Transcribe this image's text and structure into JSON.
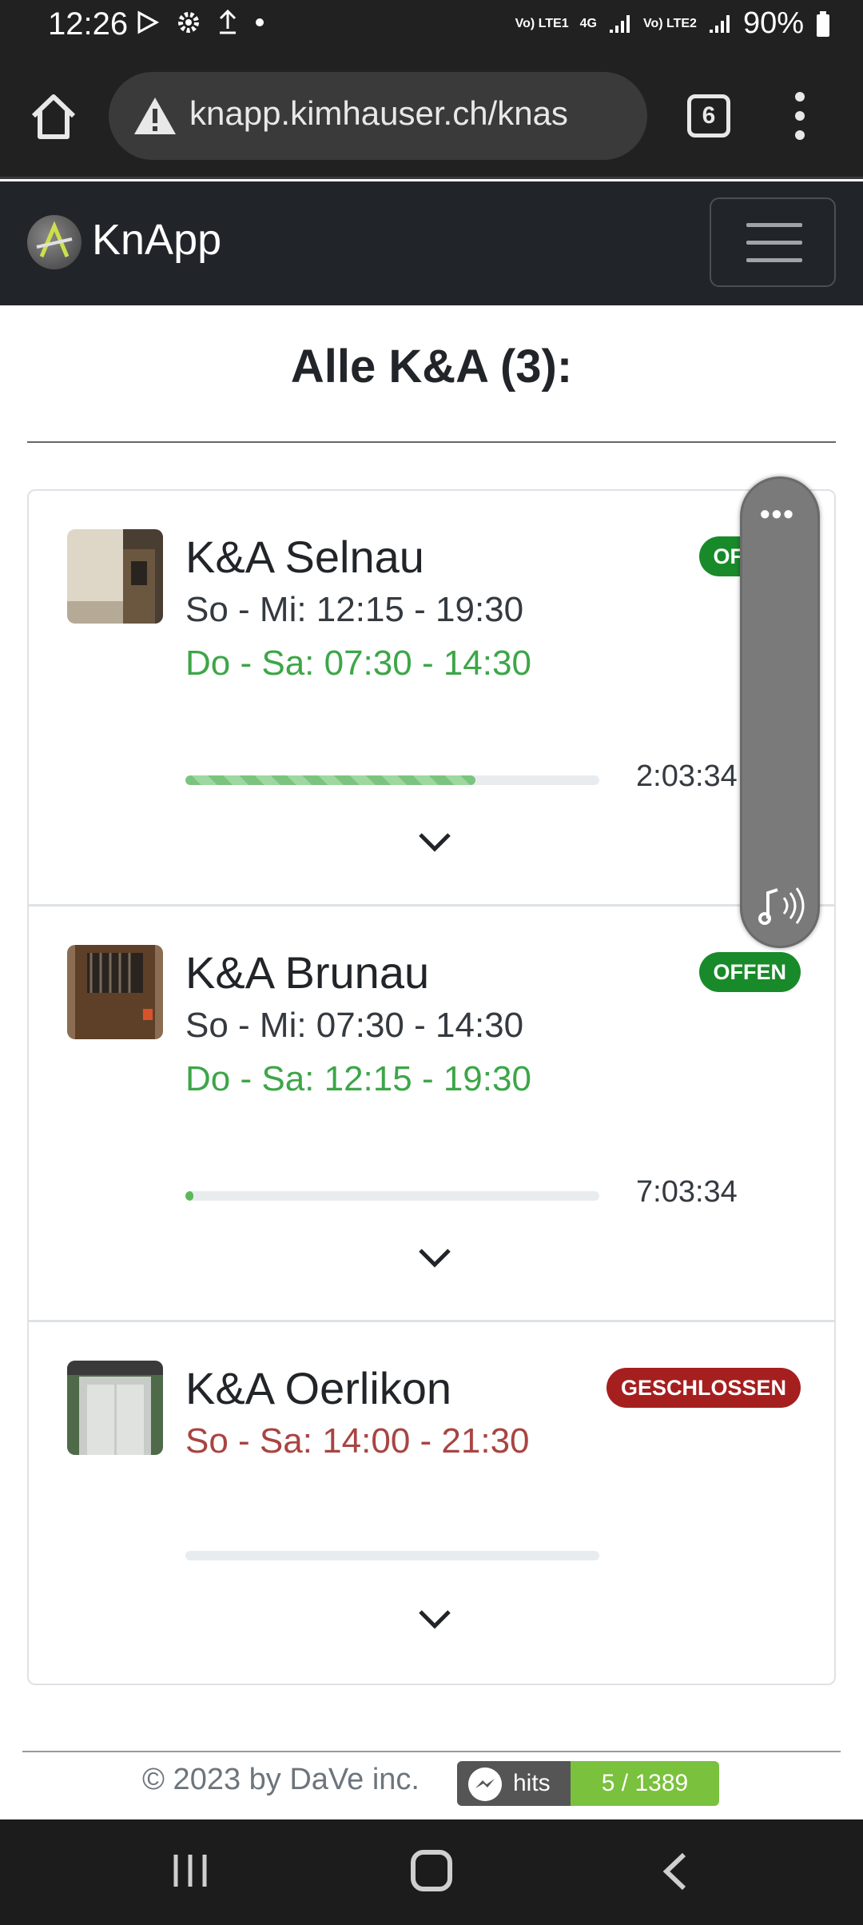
{
  "status_bar": {
    "time": "12:26",
    "battery": "90%",
    "icons": [
      "play-store-icon",
      "settings-icon",
      "upload-icon",
      "dot-icon"
    ],
    "network_1": "Vo) LTE1",
    "network_mid": "4G",
    "network_2": "Vo) LTE2"
  },
  "browser": {
    "url": "knapp.kimhauser.ch/knas",
    "tab_count": "6"
  },
  "app": {
    "brand": "KnApp"
  },
  "page": {
    "title": "Alle K&A (3):"
  },
  "locations": [
    {
      "name": "K&A Selnau",
      "line1": "So - Mi: 12:15 - 19:30",
      "line2": "Do - Sa: 07:30 - 14:30",
      "status": "OFFEN",
      "countdown": "2:03:34",
      "progress": 0.7
    },
    {
      "name": "K&A Brunau",
      "line1": "So - Mi: 07:30 - 14:30",
      "line2": "Do - Sa: 12:15 - 19:30",
      "status": "OFFEN",
      "countdown": "7:03:34",
      "progress": 0.02
    },
    {
      "name": "K&A Oerlikon",
      "line1": "So - Sa: 14:00 - 21:30",
      "status": "GESCHLOSSEN",
      "countdown": "",
      "progress": 0
    }
  ],
  "footer": {
    "copyright": "© 2023 by DaVe inc.",
    "hits_label": "hits",
    "hits_value": "5 / 1389"
  },
  "colors": {
    "open": "#198a2a",
    "closed": "#a51f1f",
    "active_hours": "#3da648",
    "closed_hours": "#a94442"
  }
}
